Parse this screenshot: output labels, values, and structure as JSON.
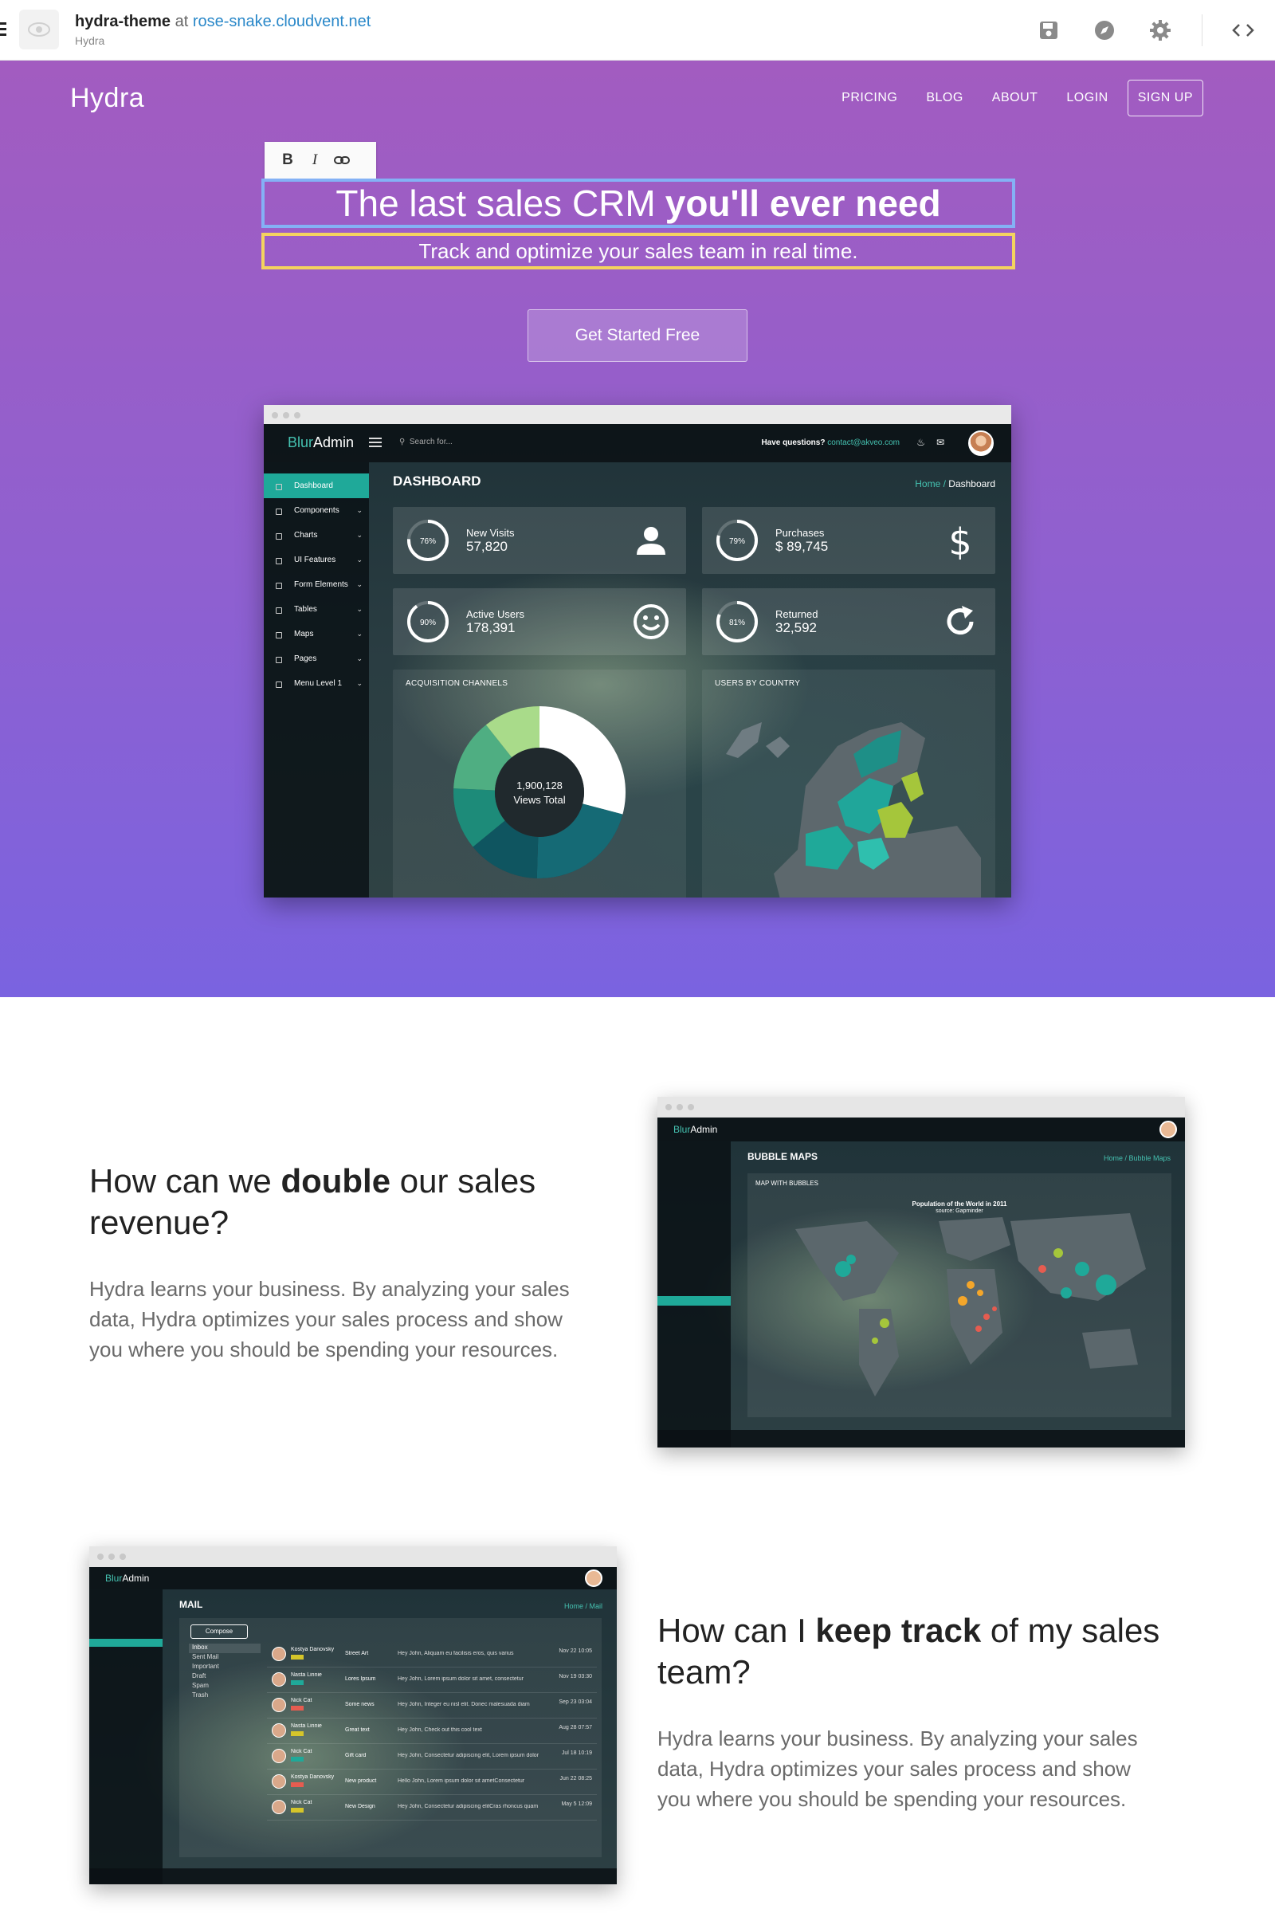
{
  "editor": {
    "site_name": "hydra-theme",
    "at": "at",
    "domain": "rose-snake.cloudvent.net",
    "subtitle": "Hydra"
  },
  "nav": {
    "brand": "Hydra",
    "items": [
      "PRICING",
      "BLOG",
      "ABOUT",
      "LOGIN"
    ],
    "signup": "SIGN UP"
  },
  "format_toolbar": {
    "bold": "B",
    "italic": "I"
  },
  "hero": {
    "headline_light": "The last sales CRM",
    "headline_bold": "you'll ever need",
    "subheadline": "Track and optimize your sales team in real time.",
    "cta": "Get Started Free"
  },
  "dashboard": {
    "logo_a": "Blur",
    "logo_b": "Admin",
    "search": "Search for...",
    "help": "Have questions?",
    "help_email": "contact@akveo.com",
    "sidebar": [
      "Dashboard",
      "Components",
      "Charts",
      "UI Features",
      "Form Elements",
      "Tables",
      "Maps",
      "Pages",
      "Menu Level 1"
    ],
    "title": "DASHBOARD",
    "crumb_home": "Home /",
    "crumb_current": "Dashboard",
    "stats": [
      {
        "pct": "76%",
        "label": "New Visits",
        "value": "57,820",
        "fraction": 0.76
      },
      {
        "pct": "79%",
        "label": "Purchases",
        "value": "$ 89,745",
        "fraction": 0.79
      },
      {
        "pct": "90%",
        "label": "Active Users",
        "value": "178,391",
        "fraction": 0.9
      },
      {
        "pct": "81%",
        "label": "Returned",
        "value": "32,592",
        "fraction": 0.81
      }
    ],
    "acquisition_title": "ACQUISITION CHANNELS",
    "views_total_value": "1,900,128",
    "views_total_label": "Views Total",
    "country_title": "USERS BY COUNTRY"
  },
  "feature1": {
    "heading_a": "How can we",
    "heading_bold": "double",
    "heading_b": "our sales revenue?",
    "body": "Hydra learns your business. By analyzing your sales data, Hydra optimizes your sales process and show you where you should be spending your resources.",
    "shot_title": "BUBBLE MAPS",
    "shot_crumb": "Home / Bubble Maps",
    "shot_panel": "MAP WITH BUBBLES",
    "shot_map_title": "Population of the World in 2011",
    "shot_map_source": "source: Gapminder"
  },
  "feature2": {
    "heading_a": "How can I",
    "heading_bold": "keep track",
    "heading_b": "of my sales team?",
    "body": "Hydra learns your business. By analyzing your sales data, Hydra optimizes your sales process and show you where you should be spending your resources.",
    "shot_title": "MAIL",
    "shot_crumb": "Home / Mail",
    "compose": "Compose",
    "folders": [
      "Inbox",
      "Sent Mail",
      "Important",
      "Draft",
      "Spam",
      "Trash"
    ],
    "mail_rows": [
      {
        "from": "Kostya Danovsky",
        "subject": "Street Art",
        "preview": "Hey John, Aliquam eu facilisis eros, quis varius",
        "date": "Nov 22 10:05"
      },
      {
        "from": "Nasta Linnie",
        "subject": "Lores Ipsum",
        "preview": "Hey John, Lorem ipsum dolor sit amet, consectetur",
        "date": "Nov 19 03:30"
      },
      {
        "from": "Nick Cat",
        "subject": "Some news",
        "preview": "Hey John, Integer eu nisl elit. Donec malesuada diam",
        "date": "Sep 23 03:04"
      },
      {
        "from": "Nasta Linnie",
        "subject": "Great text",
        "preview": "Hey John, Check out this cool text",
        "date": "Aug 28 07:57"
      },
      {
        "from": "Nick Cat",
        "subject": "Gift card",
        "preview": "Hey John, Consectetur adipiscing elit, Lorem ipsum dolor",
        "date": "Jul 18 10:19"
      },
      {
        "from": "Kostya Danovsky",
        "subject": "New product",
        "preview": "Hello John, Lorem ipsum dolor sit ametConsectetur",
        "date": "Jun 22 08:25"
      },
      {
        "from": "Nick Cat",
        "subject": "New Design",
        "preview": "Hey John, Consectetur adipiscing elitCras rhoncus quam",
        "date": "May 5 12:09"
      }
    ]
  },
  "colors": {
    "hero_top": "#a25cc0",
    "hero_bottom": "#7a63e0",
    "teal": "#1fa999",
    "headline_border": "#84b1f5",
    "subline_border": "#f4d35e"
  }
}
